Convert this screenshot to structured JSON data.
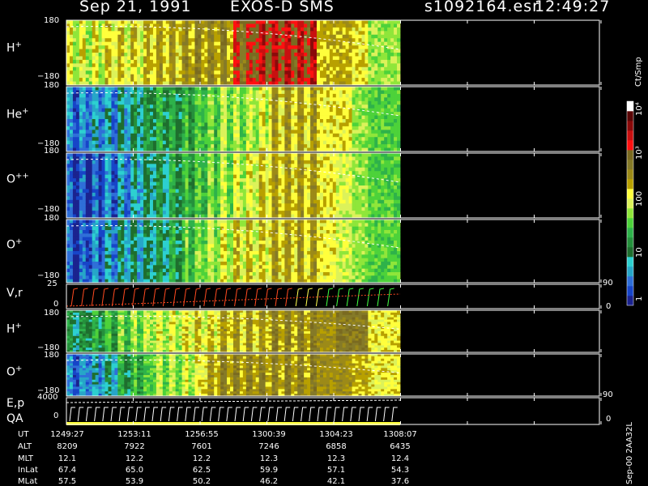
{
  "header": {
    "date": "Sep 21, 1991",
    "instrument": "EXOS-D SMS",
    "file": "s1092164.esr",
    "time": "12:49:27"
  },
  "colorbar": {
    "unit": "Ct/Smp",
    "tick_labels": [
      "1",
      "10",
      "100",
      "10³",
      "10⁴"
    ],
    "colors": [
      "#1b238f",
      "#1745c8",
      "#2f6fd8",
      "#27a6c8",
      "#2dd0d0",
      "#1e6e2e",
      "#25903c",
      "#2eb24a",
      "#4dd23a",
      "#8fe63a",
      "#dcf25a",
      "#ffff3c",
      "#b8a000",
      "#9c8a18",
      "#857a28",
      "#7a6a20",
      "#ff1010",
      "#c81010",
      "#8a0a0a",
      "#5a0606",
      "#ffffff"
    ]
  },
  "panels": [
    {
      "label": "H",
      "sup": "+",
      "ymax": "180",
      "ymin": "−180",
      "right_ticks": []
    },
    {
      "label": "He",
      "sup": "+",
      "ymax": "180",
      "ymin": "−180",
      "right_ticks": []
    },
    {
      "label": "O",
      "sup": "++",
      "ymax": "180",
      "ymin": "−180",
      "right_ticks": []
    },
    {
      "label": "O",
      "sup": "+",
      "ymax": "180",
      "ymin": "−180",
      "right_ticks": []
    },
    {
      "label": "V,r",
      "sup": "",
      "ymax": "25",
      "ymin": "0",
      "right_ticks": [
        "90",
        "0"
      ]
    },
    {
      "label": "H",
      "sup": "+",
      "ymax": "180",
      "ymin": "−180",
      "right_ticks": []
    },
    {
      "label": "O",
      "sup": "+",
      "ymax": "180",
      "ymin": "−180",
      "right_ticks": []
    },
    {
      "label": "E,p",
      "sup": "",
      "ymax": "4000",
      "ymin": "0",
      "right_ticks": [
        "90",
        "0"
      ],
      "label2": "QA"
    }
  ],
  "footer": {
    "version": "Sep-00  2AA32L",
    "rows": [
      {
        "name": "UT",
        "values": [
          "1249:27",
          "1253:11",
          "1256:55",
          "1300:39",
          "1304:23",
          "1308:07"
        ]
      },
      {
        "name": "ALT",
        "values": [
          "8209",
          "7922",
          "7601",
          "7246",
          "6858",
          "6435"
        ]
      },
      {
        "name": "MLT",
        "values": [
          "12.1",
          "12.2",
          "12.2",
          "12.3",
          "12.3",
          "12.4"
        ]
      },
      {
        "name": "InLat",
        "values": [
          "67.4",
          "65.0",
          "62.5",
          "59.9",
          "57.1",
          "54.3"
        ]
      },
      {
        "name": "MLat",
        "values": [
          "57.5",
          "53.9",
          "50.2",
          "46.2",
          "42.1",
          "37.6"
        ]
      }
    ]
  },
  "chart_data": {
    "type": "heatmap",
    "title": "Sep 21, 1991   EXOS-D SMS",
    "x": [
      "1249:27",
      "1253:11",
      "1256:55",
      "1300:39",
      "1304:23",
      "1308:07"
    ],
    "zlabel": "Ct/Smp",
    "zscale": "log",
    "zrange": [
      1,
      10000
    ],
    "series": [
      {
        "name": "H+",
        "ylim": [
          -180,
          180
        ],
        "level_per_column": [
          10,
          10,
          11,
          11,
          11,
          12,
          12,
          13,
          13,
          13,
          15,
          16,
          16,
          16,
          16,
          12,
          12,
          11,
          9,
          9
        ]
      },
      {
        "name": "He+",
        "ylim": [
          -180,
          180
        ],
        "level_per_column": [
          2,
          3,
          3,
          4,
          5,
          6,
          6,
          7,
          8,
          9,
          9,
          10,
          12,
          12,
          12,
          11,
          11,
          9,
          8,
          8
        ]
      },
      {
        "name": "O++",
        "ylim": [
          -180,
          180
        ],
        "level_per_column": [
          1,
          1,
          2,
          3,
          4,
          5,
          6,
          7,
          8,
          9,
          10,
          11,
          12,
          12,
          12,
          11,
          10,
          9,
          8,
          8
        ]
      },
      {
        "name": "O+",
        "ylim": [
          -180,
          180
        ],
        "level_per_column": [
          1,
          2,
          3,
          4,
          4,
          5,
          6,
          8,
          9,
          10,
          11,
          11,
          12,
          12,
          12,
          11,
          10,
          9,
          8,
          8
        ]
      },
      {
        "name": "H+ (lower)",
        "ylim": [
          -180,
          180
        ],
        "level_per_column": [
          5,
          6,
          7,
          8,
          9,
          10,
          10,
          11,
          11,
          12,
          12,
          12,
          13,
          13,
          13,
          13,
          14,
          14,
          11,
          11
        ]
      },
      {
        "name": "O+ (lower)",
        "ylim": [
          -180,
          180
        ],
        "level_per_column": [
          2,
          3,
          4,
          6,
          7,
          9,
          9,
          10,
          12,
          13,
          13,
          13,
          13,
          13,
          13,
          13,
          13,
          12,
          11,
          11
        ]
      }
    ]
  }
}
